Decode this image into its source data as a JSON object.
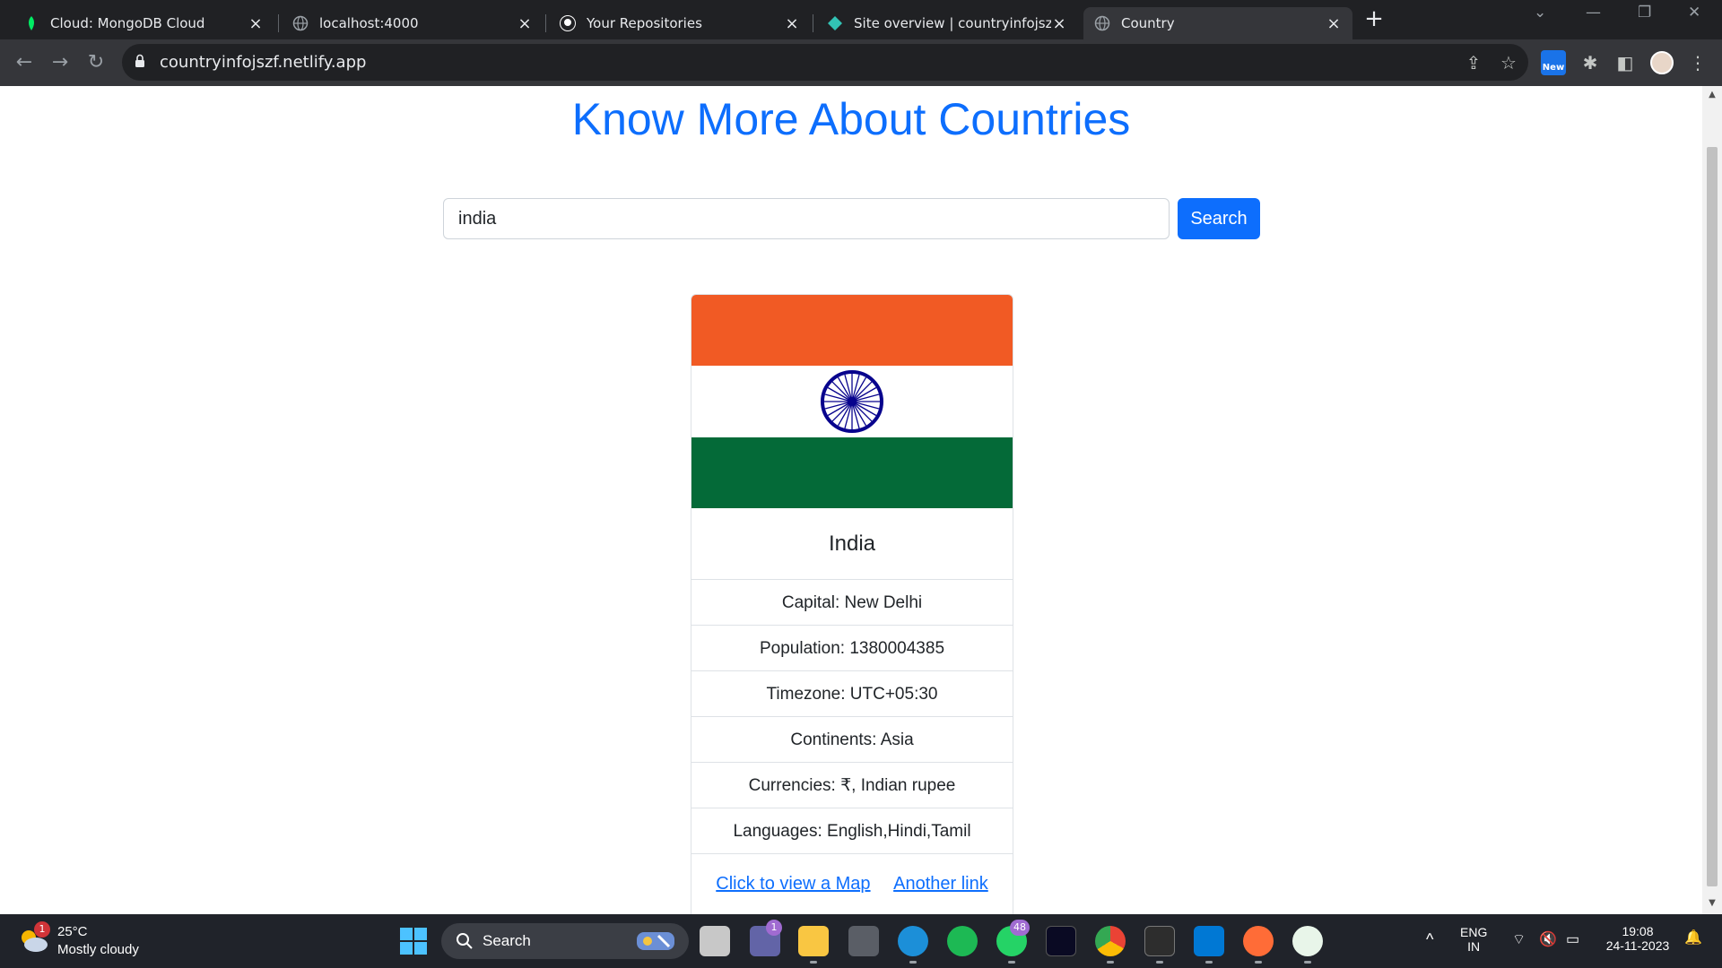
{
  "browser": {
    "tabs": [
      {
        "title": "Cloud: MongoDB Cloud",
        "favicon": "mongodb-leaf-icon"
      },
      {
        "title": "localhost:4000",
        "favicon": "globe-icon"
      },
      {
        "title": "Your Repositories",
        "favicon": "github-icon"
      },
      {
        "title": "Site overview | countryinfojszf | N",
        "favicon": "netlify-icon"
      },
      {
        "title": "Country",
        "favicon": "globe-icon",
        "active": true
      }
    ],
    "url": "countryinfojszf.netlify.app",
    "new_badge": "New"
  },
  "page": {
    "heading": "Know More About Countries",
    "search": {
      "value": "india",
      "button_label": "Search"
    },
    "country": {
      "name": "India",
      "details": [
        "Capital: New Delhi",
        "Population: 1380004385",
        "Timezone: UTC+05:30",
        "Continents: Asia",
        "Currencies: ₹, Indian rupee",
        "Languages: English,Hindi,Tamil"
      ],
      "links": [
        "Click to view a Map",
        "Another link"
      ],
      "flag_colors": {
        "saffron": "#f15a24",
        "white": "#ffffff",
        "green": "#046a38",
        "chakra": "#07038d"
      }
    },
    "accent_color": "#0d6efd"
  },
  "taskbar": {
    "weather": {
      "temp": "25°C",
      "condition": "Mostly cloudy",
      "badge": "1"
    },
    "search_label": "Search",
    "badges": {
      "teams": "1",
      "whatsapp": "48"
    },
    "language": {
      "line1": "ENG",
      "line2": "IN"
    },
    "clock": {
      "time": "19:08",
      "date": "24-11-2023"
    }
  }
}
